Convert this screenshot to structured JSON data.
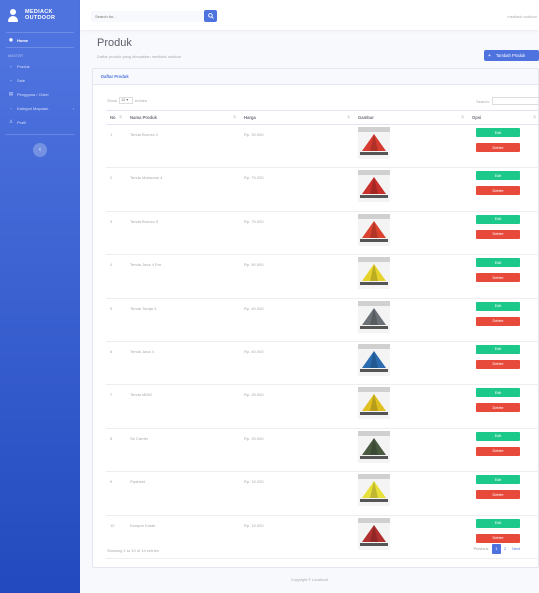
{
  "brand": {
    "line1": "MEDIACK",
    "line2": "OUTDOOR"
  },
  "sidebar": {
    "home": "Home",
    "heading": "Master",
    "items": [
      {
        "label": "Produk",
        "icon": "box-icon"
      },
      {
        "label": "Sale",
        "icon": "tag-icon"
      },
      {
        "label": "Pengguna / Order",
        "icon": "users-icon"
      },
      {
        "label": "Kategori Mapulan",
        "icon": "list-icon",
        "caret": "›"
      },
      {
        "label": "Profil",
        "icon": "user-icon"
      }
    ],
    "toggle": "‹"
  },
  "topbar": {
    "search_placeholder": "Search for...",
    "user_name": "mediack outdoor"
  },
  "page": {
    "title": "Produk",
    "subtitle": "Daftar produk yang dimuatkan mediack outdoor",
    "add_button": "Tambah Produk"
  },
  "card": {
    "header": "Daftar Produk",
    "show": "Show",
    "entries_value": "10",
    "entries": "entries",
    "search_label": "Search:"
  },
  "table": {
    "columns": [
      "No",
      "Nama Produk",
      "Harga",
      "Gambar",
      "Opsi"
    ],
    "edit_label": "Edit",
    "delete_label": "Delete",
    "rows": [
      {
        "no": "1",
        "nama": "Tenda Borneo 2",
        "harga": "Rp. 30.000",
        "color": "#d63b2f"
      },
      {
        "no": "2",
        "nama": "Tenda Malaccan 4",
        "harga": "Rp. 75.000",
        "color": "#c9302c"
      },
      {
        "no": "3",
        "nama": "Tenda Borneo 5",
        "harga": "Rp. 75.000",
        "color": "#d9432f"
      },
      {
        "no": "4",
        "nama": "Tenda Java 4 Pro",
        "harga": "Rp. 50.000",
        "color": "#e5d22a"
      },
      {
        "no": "5",
        "nama": "Tenda Toraja 4",
        "harga": "Rp. 40.000",
        "color": "#6b7177"
      },
      {
        "no": "6",
        "nama": "Tenda Java 4",
        "harga": "Rp. 40.000",
        "color": "#2b6cb0"
      },
      {
        "no": "7",
        "nama": "Tenda MDM",
        "harga": "Rp. 25.000",
        "color": "#e0c020"
      },
      {
        "no": "8",
        "nama": "Sb Carrier",
        "harga": "Rp. 25.000",
        "color": "#4a5a40"
      },
      {
        "no": "9",
        "nama": "Flysheet",
        "harga": "Rp. 15.000",
        "color": "#e8e03a"
      },
      {
        "no": "10",
        "nama": "Kompor Kotak",
        "harga": "Rp. 15.000",
        "color": "#b03030"
      }
    ]
  },
  "footer_table": {
    "showing": "Showing 1 to 10 of 14 entries",
    "previous": "Previous",
    "pages": [
      "1",
      "2"
    ],
    "next": "Next"
  },
  "footer": "Copyright © Localhost"
}
